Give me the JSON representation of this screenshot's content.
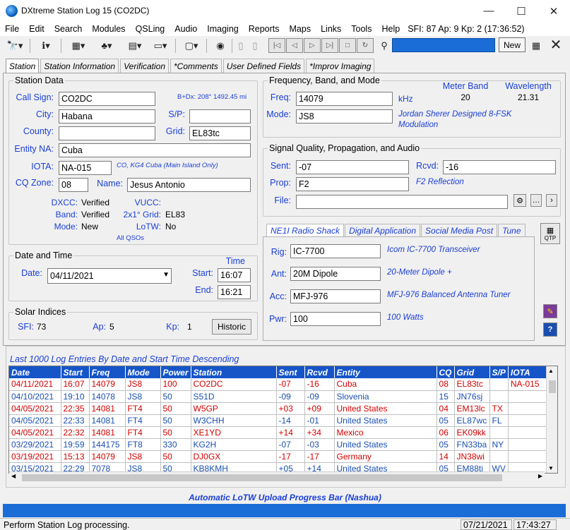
{
  "window": {
    "title": "DXtreme Station Log 15 (CO2DC)",
    "min": "—",
    "max": "☐",
    "close": "✕"
  },
  "menu": [
    "File",
    "Edit",
    "Search",
    "Modules",
    "QSLing",
    "Audio",
    "Imaging",
    "Reports",
    "Maps",
    "Links",
    "Tools",
    "Help"
  ],
  "solar_status": "SFI: 87 Ap: 9 Kp: 2 (17:36:52)",
  "toolbar": {
    "new_label": "New"
  },
  "tabs": [
    "Station",
    "Station Information",
    "Verification",
    "*Comments",
    "User Defined Fields",
    "*Improv Imaging"
  ],
  "station": {
    "legend": "Station Data",
    "callsign_label": "Call Sign:",
    "callsign": "CO2DC",
    "bearing": "B+Dx: 208° 1492.45 mi",
    "city_label": "City:",
    "city": "Habana",
    "sp_label": "S/P:",
    "sp": "",
    "county_label": "County:",
    "county": "",
    "grid_label": "Grid:",
    "grid": "EL83tc",
    "entity_label": "Entity NA:",
    "entity": "Cuba",
    "iota_label": "IOTA:",
    "iota": "NA-015",
    "iota_note": "CO, KG4 Cuba (Main Island Only)",
    "cq_label": "CQ Zone:",
    "cq": "08",
    "name_label": "Name:",
    "name": "Jesus Antonio",
    "dxcc_label": "DXCC:",
    "dxcc": "Verified",
    "band_label": "Band:",
    "band": "Verified",
    "mode_label": "Mode:",
    "mode": "New",
    "vucc_label": "VUCC:",
    "grid2_label": "2x1° Grid:",
    "grid2": "EL83",
    "lotw_label": "LoTW:",
    "lotw": "No",
    "all_qsos": "All QSOs"
  },
  "datetime": {
    "legend": "Date and Time",
    "date_label": "Date:",
    "date": "04/11/2021",
    "time_header": "Time",
    "start_label": "Start:",
    "start": "16:07",
    "end_label": "End:",
    "end": "16:21"
  },
  "solar": {
    "legend": "Solar Indices",
    "sfi_label": "SFI:",
    "sfi": "73",
    "ap_label": "Ap:",
    "ap": "5",
    "kp_label": "Kp:",
    "kp": "1",
    "historic_button": "Historic"
  },
  "freq": {
    "legend": "Frequency, Band, and Mode",
    "freq_label": "Freq:",
    "freq": "14079",
    "unit": "kHz",
    "meter_band_label": "Meter Band",
    "meter_band": "20",
    "wavelength_label": "Wavelength",
    "wavelength": "21.31",
    "mode_label": "Mode:",
    "mode": "JS8",
    "mode_note": "Jordan Sherer Designed 8-FSK Modulation"
  },
  "signal": {
    "legend": "Signal Quality, Propagation, and Audio",
    "sent_label": "Sent:",
    "sent": "-07",
    "rcvd_label": "Rcvd:",
    "rcvd": "-16",
    "prop_label": "Prop:",
    "prop": "F2",
    "prop_note": "F2 Reflection",
    "file_label": "File:",
    "file": ""
  },
  "equipment": {
    "subtabs": [
      "NE1I Radio Shack",
      "Digital Application",
      "Social Media Post",
      "Tune"
    ],
    "rig_label": "Rig:",
    "rig": "IC-7700",
    "rig_note": "Icom IC-7700 Transceiver",
    "ant_label": "Ant:",
    "ant": "20M Dipole",
    "ant_note": "20-Meter Dipole +",
    "acc_label": "Acc:",
    "acc": "MFJ-976",
    "acc_note": "MFJ-976 Balanced Antenna Tuner",
    "pwr_label": "Pwr:",
    "pwr": "100",
    "pwr_note": "100 Watts"
  },
  "log": {
    "title": "Last 1000 Log Entries By Date and Start Time Descending",
    "columns": [
      "Date",
      "Start",
      "Freq",
      "Mode",
      "Power",
      "Station",
      "Sent",
      "Rcvd",
      "Entity",
      "CQ",
      "Grid",
      "S/P",
      "IOTA"
    ],
    "rows": [
      {
        "color": "red",
        "cells": [
          "04/11/2021",
          "16:07",
          "14079",
          "JS8",
          "100",
          "CO2DC",
          "-07",
          "-16",
          "Cuba",
          "08",
          "EL83tc",
          "",
          "NA-015"
        ]
      },
      {
        "color": "blue",
        "cells": [
          "04/10/2021",
          "19:10",
          "14078",
          "JS8",
          "50",
          "S51D",
          "-09",
          "-09",
          "Slovenia",
          "15",
          "JN76sj",
          "",
          ""
        ]
      },
      {
        "color": "red",
        "cells": [
          "04/05/2021",
          "22:35",
          "14081",
          "FT4",
          "50",
          "W5GP",
          "+03",
          "+09",
          "United States",
          "04",
          "EM13lc",
          "TX",
          ""
        ]
      },
      {
        "color": "blue",
        "cells": [
          "04/05/2021",
          "22:33",
          "14081",
          "FT4",
          "50",
          "W3CHH",
          "-14",
          "-01",
          "United States",
          "05",
          "EL87wc",
          "FL",
          ""
        ]
      },
      {
        "color": "red",
        "cells": [
          "04/05/2021",
          "22:32",
          "14081",
          "FT4",
          "50",
          "XE1YD",
          "+14",
          "+34",
          "Mexico",
          "06",
          "EK09kk",
          "",
          ""
        ]
      },
      {
        "color": "blue",
        "cells": [
          "03/29/2021",
          "19:59",
          "144175",
          "FT8",
          "330",
          "KG2H",
          "-07",
          "-03",
          "United States",
          "05",
          "FN33ba",
          "NY",
          ""
        ]
      },
      {
        "color": "red",
        "cells": [
          "03/19/2021",
          "15:13",
          "14079",
          "JS8",
          "50",
          "DJ0GX",
          "-17",
          "-17",
          "Germany",
          "14",
          "JN38wi",
          "",
          ""
        ]
      },
      {
        "color": "blue",
        "cells": [
          "03/15/2021",
          "22:29",
          "7078",
          "JS8",
          "50",
          "KB8KMH",
          "+05",
          "+14",
          "United States",
          "05",
          "EM88ti",
          "WV",
          ""
        ]
      }
    ]
  },
  "progress_label": "Automatic LoTW Upload Progress Bar (Nashua)",
  "status": {
    "message": "Perform Station Log processing.",
    "date": "07/21/2021",
    "time": "17:43:27"
  },
  "side_icons": {
    "qtp": "QTP"
  }
}
